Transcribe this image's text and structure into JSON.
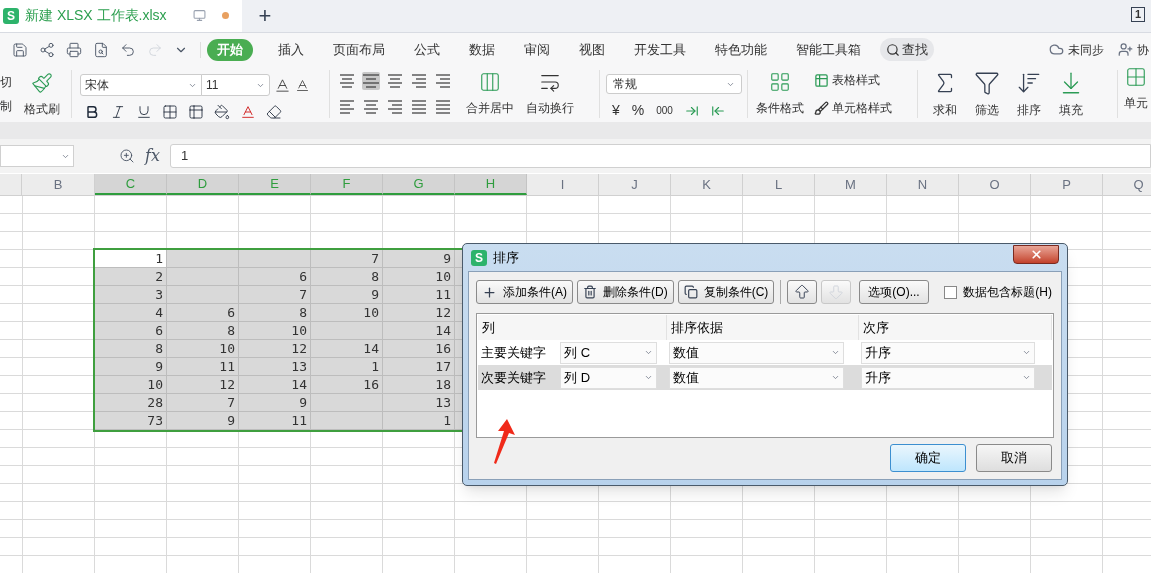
{
  "title_bar": {
    "logo": "S",
    "tab_title": "新建 XLSX 工作表.xlsx",
    "unsaved": true,
    "new_tab": "+",
    "window_count": "1"
  },
  "menu": {
    "tabs": [
      {
        "label": "开始",
        "selected": true
      },
      {
        "label": "插入",
        "selected": false
      },
      {
        "label": "页面布局",
        "selected": false
      },
      {
        "label": "公式",
        "selected": false
      },
      {
        "label": "数据",
        "selected": false
      },
      {
        "label": "审阅",
        "selected": false
      },
      {
        "label": "视图",
        "selected": false
      },
      {
        "label": "开发工具",
        "selected": false
      },
      {
        "label": "特色功能",
        "selected": false
      },
      {
        "label": "智能工具箱",
        "selected": false
      }
    ],
    "search": "查找",
    "sync": "未同步",
    "share": "协"
  },
  "ribbon": {
    "cut": "切",
    "copy": "制",
    "format_painter": "格式刷",
    "font": "宋体",
    "size": "11",
    "merge": "合并居中",
    "wrap": "自动换行",
    "number_format": "常规",
    "currency": "¥",
    "percent": "%",
    "thousands": "000",
    "conditional": "条件格式",
    "table_style": "表格样式",
    "cell_style": "单元格样式",
    "tools": [
      {
        "kind": "sum",
        "label": "求和"
      },
      {
        "kind": "filter",
        "label": "筛选"
      },
      {
        "kind": "sort",
        "label": "排序"
      },
      {
        "kind": "fill",
        "label": "填充"
      }
    ],
    "cells": "单元"
  },
  "formula_bar": {
    "fx": "fx",
    "value": "1"
  },
  "sheet": {
    "columns": [
      {
        "label": "B",
        "selected": false
      },
      {
        "label": "C",
        "selected": true
      },
      {
        "label": "D",
        "selected": true
      },
      {
        "label": "E",
        "selected": true
      },
      {
        "label": "F",
        "selected": true
      },
      {
        "label": "G",
        "selected": true
      },
      {
        "label": "H",
        "selected": true
      },
      {
        "label": "I",
        "selected": false
      },
      {
        "label": "J",
        "selected": false
      },
      {
        "label": "K",
        "selected": false
      },
      {
        "label": "L",
        "selected": false
      },
      {
        "label": "M",
        "selected": false
      },
      {
        "label": "N",
        "selected": false
      },
      {
        "label": "O",
        "selected": false
      },
      {
        "label": "P",
        "selected": false
      },
      {
        "label": "Q",
        "selected": false
      }
    ],
    "data_rows": [
      {
        "active": true,
        "cells": [
          "1",
          null,
          null,
          "7",
          "9"
        ]
      },
      {
        "active": false,
        "cells": [
          "2",
          null,
          "6",
          "8",
          "10"
        ]
      },
      {
        "active": false,
        "cells": [
          "3",
          null,
          "7",
          "9",
          "11"
        ]
      },
      {
        "active": false,
        "cells": [
          "4",
          "6",
          "8",
          "10",
          "12"
        ]
      },
      {
        "active": false,
        "cells": [
          "6",
          "8",
          "10",
          null,
          "14"
        ]
      },
      {
        "active": false,
        "cells": [
          "8",
          "10",
          "12",
          "14",
          "16"
        ]
      },
      {
        "active": false,
        "cells": [
          "9",
          "11",
          "13",
          "1",
          "17"
        ]
      },
      {
        "active": false,
        "cells": [
          "10",
          "12",
          "14",
          "16",
          "18"
        ]
      },
      {
        "active": false,
        "cells": [
          "28",
          "7",
          "9",
          null,
          "13"
        ]
      },
      {
        "active": false,
        "cells": [
          "73",
          "9",
          "11",
          null,
          "1"
        ]
      }
    ]
  },
  "dialog": {
    "logo": "S",
    "title": "排序",
    "toolbar": [
      {
        "kind": "add",
        "label": "添加条件(A)",
        "disabled": false
      },
      {
        "kind": "delete",
        "label": "删除条件(D)",
        "disabled": false
      },
      {
        "kind": "copy",
        "label": "复制条件(C)",
        "disabled": false
      },
      {
        "kind": "up",
        "disabled": false
      },
      {
        "kind": "down",
        "disabled": true
      },
      {
        "kind": "options",
        "label": "选项(O)...",
        "disabled": false
      }
    ],
    "header_checkbox": {
      "label": "数据包含标题(H)",
      "checked": false
    },
    "columns": [
      "列",
      "排序依据",
      "次序"
    ],
    "rows": [
      {
        "label": "主要关键字",
        "column": "列 C",
        "basis": "数值",
        "order": "升序",
        "selected": false
      },
      {
        "label": "次要关键字",
        "column": "列 D",
        "basis": "数值",
        "order": "升序",
        "selected": true
      }
    ],
    "buttons": [
      {
        "label": "确定",
        "default": true
      },
      {
        "label": "取消",
        "default": false
      }
    ]
  }
}
